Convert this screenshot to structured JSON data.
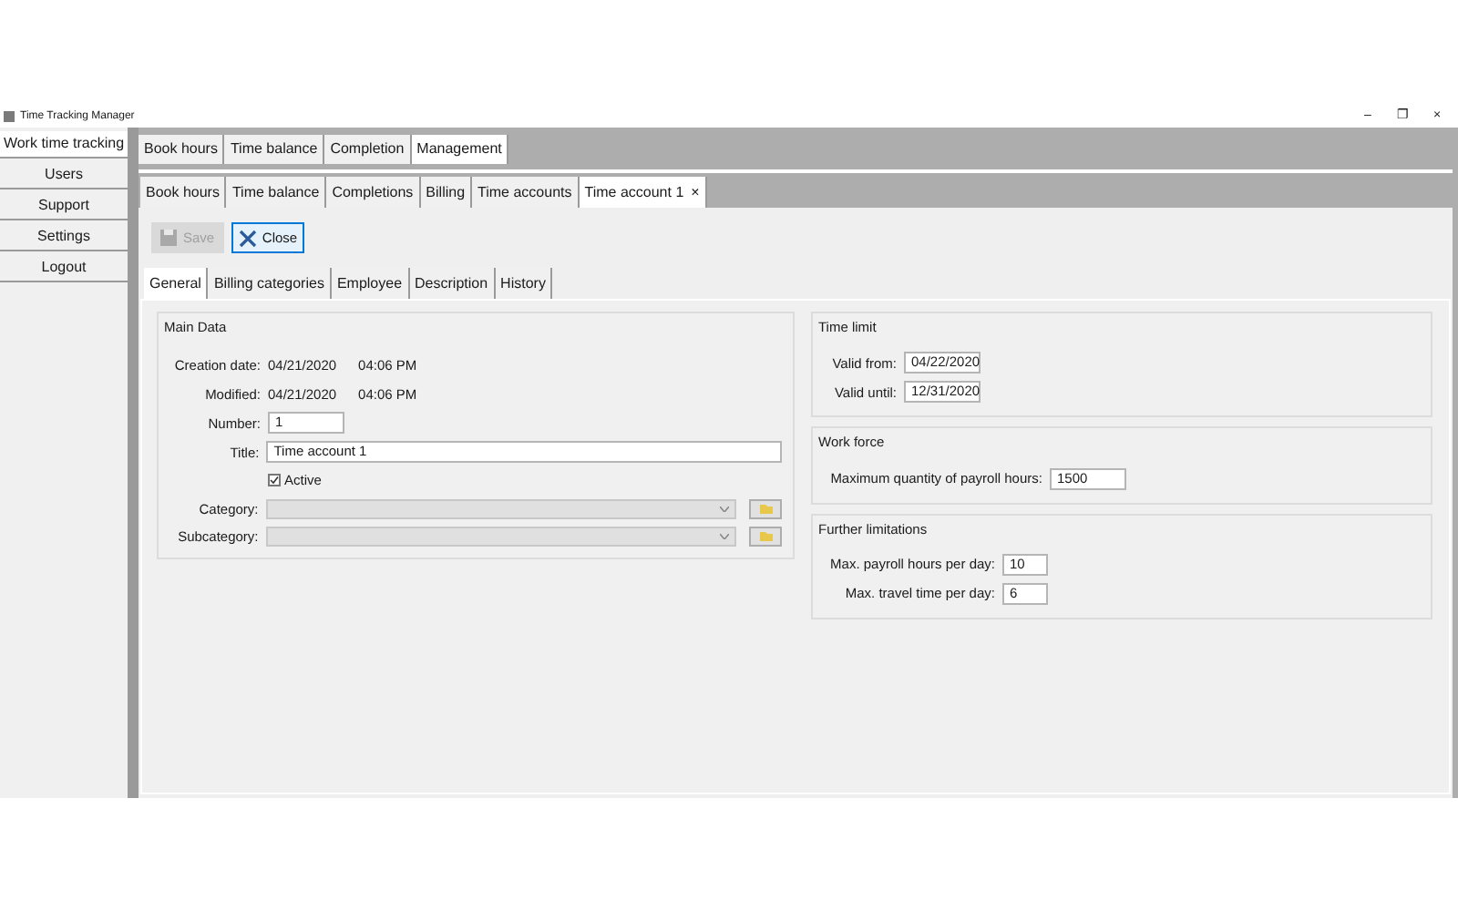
{
  "window": {
    "title": "Time Tracking Manager",
    "controls": [
      "–",
      "❐",
      "×"
    ]
  },
  "sidebar": {
    "items": [
      {
        "label": "Work time tracking",
        "selected": true
      },
      {
        "label": "Users",
        "selected": false
      },
      {
        "label": "Support",
        "selected": false
      },
      {
        "label": "Settings",
        "selected": false
      },
      {
        "label": "Logout",
        "selected": false
      }
    ]
  },
  "outer_tabs": [
    {
      "label": "Book hours",
      "selected": false
    },
    {
      "label": "Time balance",
      "selected": false
    },
    {
      "label": "Completion",
      "selected": false
    },
    {
      "label": "Management",
      "selected": true
    }
  ],
  "inner_tabs": [
    {
      "label": "Book hours",
      "selected": false
    },
    {
      "label": "Time balance",
      "selected": false
    },
    {
      "label": "Completions",
      "selected": false
    },
    {
      "label": "Billing",
      "selected": false
    },
    {
      "label": "Time accounts",
      "selected": false
    },
    {
      "label": "Time account 1",
      "selected": true,
      "close": "×"
    }
  ],
  "toolbar": {
    "save": {
      "label": "Save",
      "disabled": true
    },
    "close": {
      "label": "Close",
      "disabled": false
    }
  },
  "sub_tabs": [
    {
      "label": "General",
      "selected": true
    },
    {
      "label": "Billing categories",
      "selected": false
    },
    {
      "label": "Employee",
      "selected": false
    },
    {
      "label": "Description",
      "selected": false
    },
    {
      "label": "History",
      "selected": false
    }
  ],
  "main_data": {
    "title": "Main Data",
    "creation_date": {
      "label": "Creation date:",
      "date": "04/21/2020",
      "time": "04:06 PM"
    },
    "modified": {
      "label": "Modified:",
      "date": "04/21/2020",
      "time": "04:06 PM"
    },
    "number": {
      "label": "Number:",
      "value": "1"
    },
    "title_field": {
      "label": "Title:",
      "value": "Time account 1"
    },
    "active": {
      "label": "Active",
      "checked": true
    },
    "category": {
      "label": "Category:",
      "disabled": true
    },
    "subcategory": {
      "label": "Subcategory:",
      "disabled": true
    }
  },
  "time_limit": {
    "title": "Time limit",
    "fields": [
      {
        "label": "Valid from:",
        "value": "04/22/2020"
      },
      {
        "label": "Valid until:",
        "value": "12/31/2020"
      }
    ]
  },
  "work_force": {
    "title": "Work force",
    "fields": [
      {
        "label": "Maximum quantity of payroll hours:",
        "value": "1500"
      }
    ]
  },
  "further_limitations": {
    "title": "Further limitations",
    "fields": [
      {
        "label": "Max. payroll hours per day:",
        "value": "10"
      },
      {
        "label": "Max. travel time per day:",
        "value": "6"
      }
    ]
  }
}
